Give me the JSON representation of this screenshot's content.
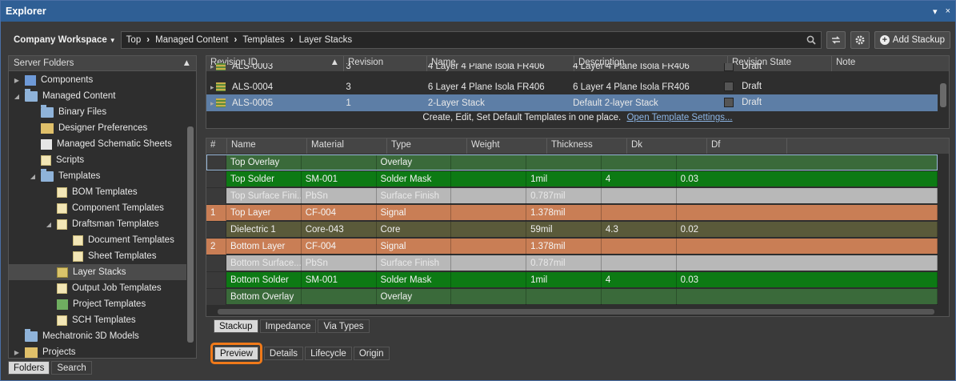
{
  "window": {
    "title": "Explorer",
    "menu_icon": "▾",
    "close_icon": "×"
  },
  "topbar": {
    "workspace": "Company Workspace",
    "breadcrumb": [
      "Top",
      "Managed Content",
      "Templates",
      "Layer Stacks"
    ],
    "add_stackup": "Add Stackup"
  },
  "left": {
    "header": "Server Folders",
    "items": [
      {
        "label": "Components",
        "icon": "comp",
        "level": 1,
        "arrow": "▶"
      },
      {
        "label": "Managed Content",
        "icon": "folder",
        "level": 1,
        "arrow": "◢"
      },
      {
        "label": "Binary Files",
        "icon": "folder",
        "level": 2,
        "arrow": ""
      },
      {
        "label": "Designer Preferences",
        "icon": "pref",
        "level": 2,
        "arrow": ""
      },
      {
        "label": "Managed Schematic Sheets",
        "icon": "sch",
        "level": 2,
        "arrow": ""
      },
      {
        "label": "Scripts",
        "icon": "doc",
        "level": 2,
        "arrow": ""
      },
      {
        "label": "Templates",
        "icon": "folder",
        "level": 2,
        "arrow": "◢"
      },
      {
        "label": "BOM Templates",
        "icon": "doc",
        "level": 3,
        "arrow": ""
      },
      {
        "label": "Component Templates",
        "icon": "doc",
        "level": 3,
        "arrow": ""
      },
      {
        "label": "Draftsman Templates",
        "icon": "doc",
        "level": 3,
        "arrow": "◢"
      },
      {
        "label": "Document Templates",
        "icon": "doc",
        "level": 4,
        "arrow": ""
      },
      {
        "label": "Sheet Templates",
        "icon": "doc",
        "level": 4,
        "arrow": ""
      },
      {
        "label": "Layer Stacks",
        "icon": "layers",
        "level": 3,
        "arrow": "",
        "selected": true
      },
      {
        "label": "Output Job Templates",
        "icon": "doc",
        "level": 3,
        "arrow": ""
      },
      {
        "label": "Project Templates",
        "icon": "proj",
        "level": 3,
        "arrow": ""
      },
      {
        "label": "SCH Templates",
        "icon": "doc",
        "level": 3,
        "arrow": ""
      },
      {
        "label": "Mechatronic 3D Models",
        "icon": "folder",
        "level": 1,
        "arrow": ""
      },
      {
        "label": "Projects",
        "icon": "pref",
        "level": 1,
        "arrow": "▶"
      }
    ],
    "tabs": [
      "Folders",
      "Search"
    ]
  },
  "revisions": {
    "columns": [
      "Revision ID",
      "Revision",
      "Name",
      "Description",
      "Revision State",
      "Note"
    ],
    "rows": [
      {
        "id": "ALS-0003",
        "rev": "3",
        "name": "4 Layer 4 Plane Isola FR406",
        "desc": "4 Layer 4 Plane Isola FR406",
        "state": "Draft"
      },
      {
        "id": "ALS-0004",
        "rev": "3",
        "name": "6 Layer 4 Plane Isola FR406",
        "desc": "6 Layer 4 Plane Isola FR406",
        "state": "Draft"
      },
      {
        "id": "ALS-0005",
        "rev": "1",
        "name": "2-Layer Stack",
        "desc": "Default 2-layer Stack",
        "state": "Draft",
        "selected": true
      }
    ],
    "note_text": "Create, Edit, Set Default Templates in one place.",
    "note_link": "Open Template Settings..."
  },
  "stack": {
    "columns": [
      "#",
      "Name",
      "Material",
      "Type",
      "Weight",
      "Thickness",
      "Dk",
      "Df"
    ],
    "rows": [
      {
        "kind": "overlay",
        "num": "",
        "name": "Top Overlay",
        "material": "",
        "type": "Overlay",
        "weight": "",
        "thickness": "",
        "dk": "",
        "df": "",
        "sel": true
      },
      {
        "kind": "solder",
        "num": "",
        "name": "Top Solder",
        "material": "SM-001",
        "type": "Solder Mask",
        "weight": "",
        "thickness": "1mil",
        "dk": "4",
        "df": "0.03"
      },
      {
        "kind": "surface",
        "num": "",
        "name": "Top Surface Fini...",
        "material": "PbSn",
        "type": "Surface Finish",
        "weight": "",
        "thickness": "0.787mil",
        "dk": "",
        "df": ""
      },
      {
        "kind": "signal",
        "num": "1",
        "name": "Top Layer",
        "material": "CF-004",
        "type": "Signal",
        "weight": "",
        "thickness": "1.378mil",
        "dk": "",
        "df": ""
      },
      {
        "kind": "core",
        "num": "",
        "name": "Dielectric 1",
        "material": "Core-043",
        "type": "Core",
        "weight": "",
        "thickness": "59mil",
        "dk": "4.3",
        "df": "0.02"
      },
      {
        "kind": "signal",
        "num": "2",
        "name": "Bottom Layer",
        "material": "CF-004",
        "type": "Signal",
        "weight": "",
        "thickness": "1.378mil",
        "dk": "",
        "df": ""
      },
      {
        "kind": "surface",
        "num": "",
        "name": "Bottom Surface...",
        "material": "PbSn",
        "type": "Surface Finish",
        "weight": "",
        "thickness": "0.787mil",
        "dk": "",
        "df": ""
      },
      {
        "kind": "solder",
        "num": "",
        "name": "Bottom Solder",
        "material": "SM-001",
        "type": "Solder Mask",
        "weight": "",
        "thickness": "1mil",
        "dk": "4",
        "df": "0.03"
      },
      {
        "kind": "overlay",
        "num": "",
        "name": "Bottom Overlay",
        "material": "",
        "type": "Overlay",
        "weight": "",
        "thickness": "",
        "dk": "",
        "df": ""
      }
    ],
    "subtabs": [
      "Stackup",
      "Impedance",
      "Via Types"
    ]
  },
  "bottom_tabs": [
    "Preview",
    "Details",
    "Lifecycle",
    "Origin"
  ]
}
